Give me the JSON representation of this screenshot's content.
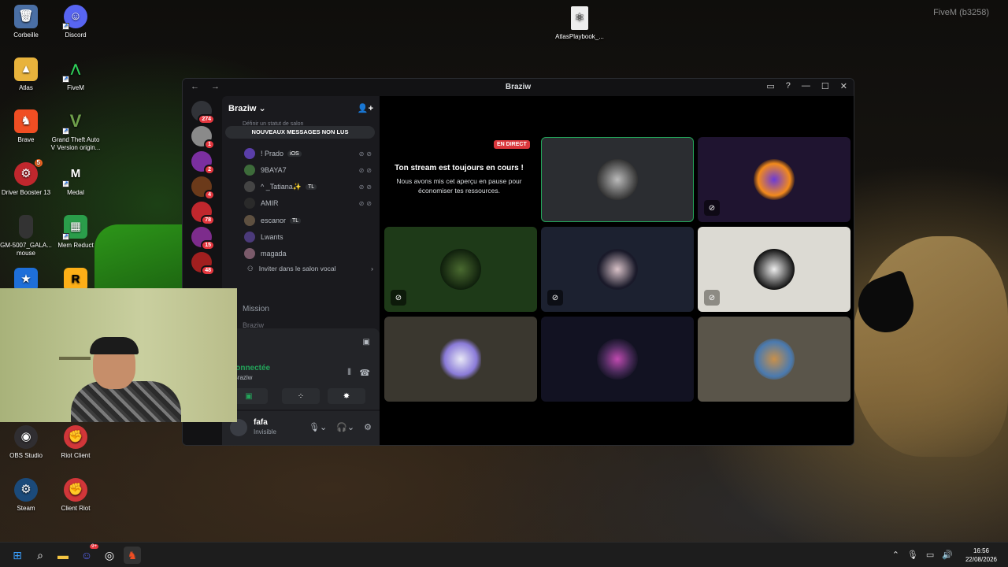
{
  "desktop": {
    "corner_label": "FiveM (b3258)",
    "icons": [
      {
        "label": "Corbeille",
        "icon": "recycle-bin-icon"
      },
      {
        "label": "Discord",
        "icon": "discord-icon"
      },
      {
        "label": "Atlas",
        "icon": "folder-icon"
      },
      {
        "label": "FiveM",
        "icon": "fivem-icon"
      },
      {
        "label": "Brave",
        "icon": "brave-icon"
      },
      {
        "label": "Grand Theft Auto V Version origin...",
        "icon": "gta-icon"
      },
      {
        "label": "Driver Booster 13",
        "icon": "driver-booster-icon",
        "badge": "5"
      },
      {
        "label": "Medal",
        "icon": "medal-icon"
      },
      {
        "label": "GM-5007_GALA... mouse",
        "icon": "mouse-icon"
      },
      {
        "label": "Mem Reduct",
        "icon": "mem-reduct-icon"
      },
      {
        "label": "",
        "icon": "app-icon"
      },
      {
        "label": "",
        "icon": "rockstar-icon"
      },
      {
        "label": "OBS Studio",
        "icon": "obs-icon"
      },
      {
        "label": "Riot Client",
        "icon": "riot-icon"
      },
      {
        "label": "Steam",
        "icon": "steam-icon"
      },
      {
        "label": "Client Riot",
        "icon": "riot-icon"
      },
      {
        "label": "AtlasPlaybook_...",
        "icon": "file-icon"
      }
    ]
  },
  "discord": {
    "window_title": "Braziw",
    "server_name": "Braziw",
    "status_line": "Définir un statut de salon",
    "new_messages_label": "NOUVEAUX MESSAGES NON LUS",
    "guild_badges": [
      "274",
      "1",
      "2",
      "4",
      "78",
      "15",
      "48"
    ],
    "voice_users": [
      {
        "name": "! Prado",
        "tag": "iOS"
      },
      {
        "name": "9BAYA7",
        "tag": ""
      },
      {
        "name": "^ _Tatiana✨",
        "tag": "TL"
      },
      {
        "name": "AMIR",
        "tag": ""
      },
      {
        "name": "escanor",
        "tag": "TL"
      },
      {
        "name": "Lwants",
        "tag": ""
      },
      {
        "name": "magada",
        "tag": ""
      }
    ],
    "invite_label": "Inviter dans le salon vocal",
    "channels": {
      "mission": "Mission",
      "braziw": "Braziw"
    },
    "voice_panel": {
      "connected": "Connectée",
      "server": "/ Braziw"
    },
    "user": {
      "name": "fafa",
      "status": "Invisible"
    },
    "stream": {
      "live_label": "EN DIRECT",
      "title": "Ton stream est toujours en cours !",
      "subtitle": "Nous avons mis cet aperçu en pause pour économiser tes ressources."
    },
    "colors": {
      "accent": "#5865f2",
      "live": "#da373c",
      "connected": "#23a55a"
    }
  },
  "taskbar": {
    "time": "16:56",
    "date": "22/08/2026",
    "discord_badge": "9+"
  }
}
